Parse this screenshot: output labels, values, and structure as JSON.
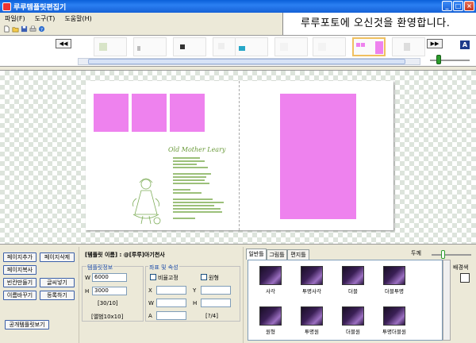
{
  "window": {
    "title": "루루템플릿편집기",
    "buttons": [
      "_",
      "□",
      "×"
    ]
  },
  "menu": {
    "items": [
      "파일(F)",
      "도구(T)",
      "도움말(H)"
    ]
  },
  "toolbar": {
    "icons": [
      "new-file-icon",
      "open-folder-icon",
      "save-icon",
      "print-icon",
      "help-icon"
    ]
  },
  "welcome_text": "루루포토에 오신것을 환영합니다.",
  "thumbstrip": {
    "prev_label": "◀◀",
    "next_label": "▶▶",
    "text_size_label": "A"
  },
  "canvas": {
    "poem_title": "Old Mother Leary",
    "accent_color": "#ee82ee"
  },
  "page_buttons": {
    "add": "페이지추가",
    "delete": "페이지삭제",
    "copy": "페이지복사",
    "fill_blanks": "빈칸만들기",
    "add_text": "글씨넣기",
    "rename": "이름바꾸기",
    "register": "등록하기",
    "public_template": "공개템플릿보기"
  },
  "template": {
    "name_label": "[템플릿 이름] : @[루루]아기천사",
    "info_label": "템플릿정보",
    "width_label": "W",
    "width_value": "6000",
    "height_label": "H",
    "height_value": "3000",
    "ratio": "[30/10]",
    "album": "[앨범10x10]"
  },
  "coords": {
    "title": "좌표 및 속성",
    "fix_ratio": "비율고정",
    "circle": "원형",
    "x": "X",
    "y": "Y",
    "w": "W",
    "h": "H",
    "a": "A",
    "page_index": "[?/4]"
  },
  "frames": {
    "tabs": [
      "일반틀",
      "그림틀",
      "편지틀"
    ],
    "thickness_label": "두께",
    "background_label": "배경색",
    "items": [
      "사각",
      "투명사각",
      "더블",
      "더블투명",
      "원형",
      "투명원",
      "더블원",
      "투명더블원"
    ]
  }
}
